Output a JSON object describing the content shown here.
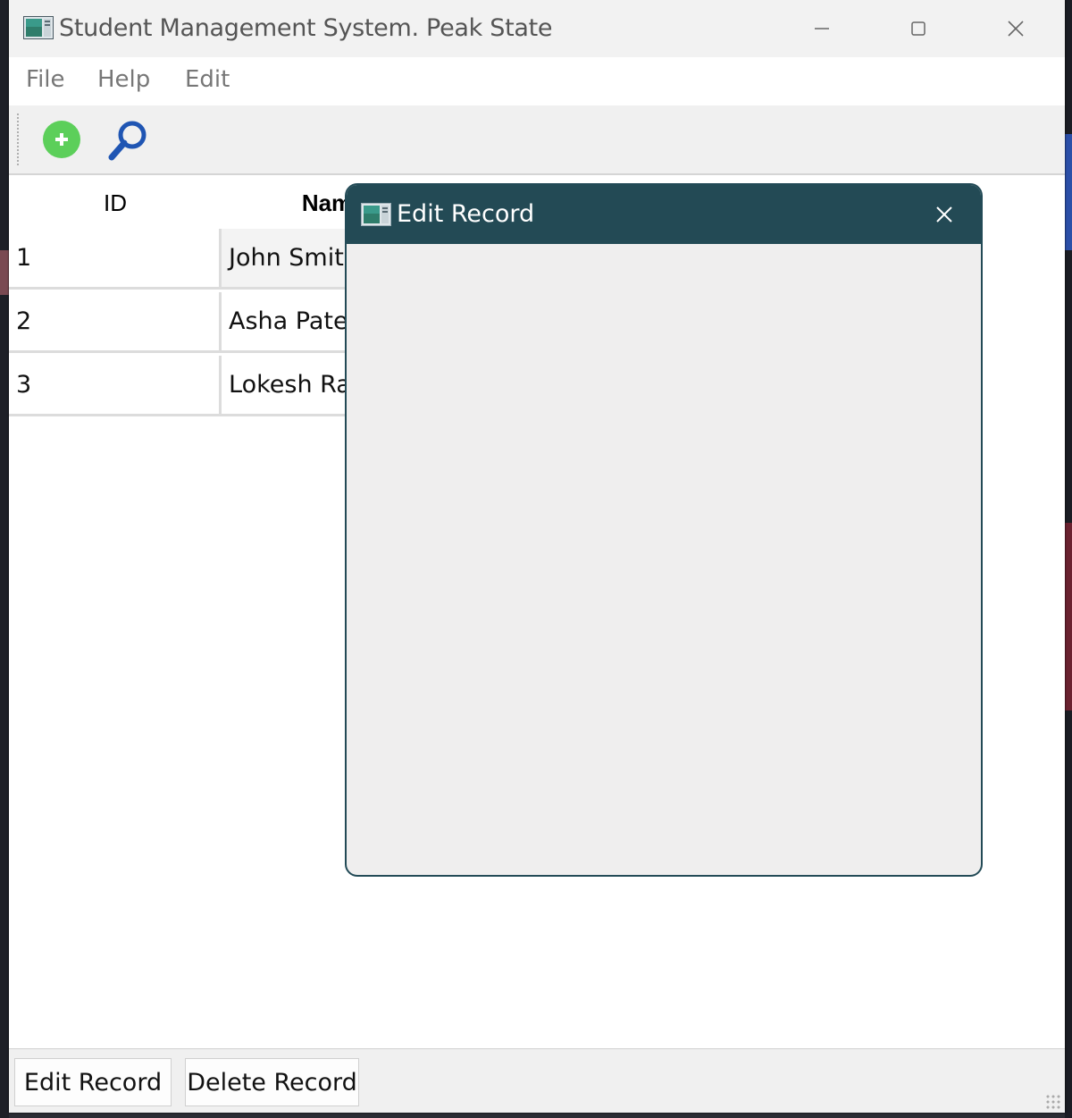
{
  "window": {
    "title": "Student Management System. Peak State"
  },
  "menu": [
    "File",
    "Help",
    "Edit"
  ],
  "toolbar": {
    "add_icon": "plus-circle-icon",
    "search_icon": "magnifier-icon",
    "add_color": "#5ccf5a",
    "search_color": "#1f55b3"
  },
  "table": {
    "headers": [
      "ID",
      "Nam"
    ],
    "rows": [
      {
        "id": "1",
        "name": "John Smith"
      },
      {
        "id": "2",
        "name": "Asha Patel"
      },
      {
        "id": "3",
        "name": "Lokesh Ra"
      }
    ]
  },
  "buttons": {
    "edit": "Edit Record",
    "delete": "Delete Record"
  },
  "dialog": {
    "title": "Edit Record",
    "titlebar_color": "#234a55"
  }
}
